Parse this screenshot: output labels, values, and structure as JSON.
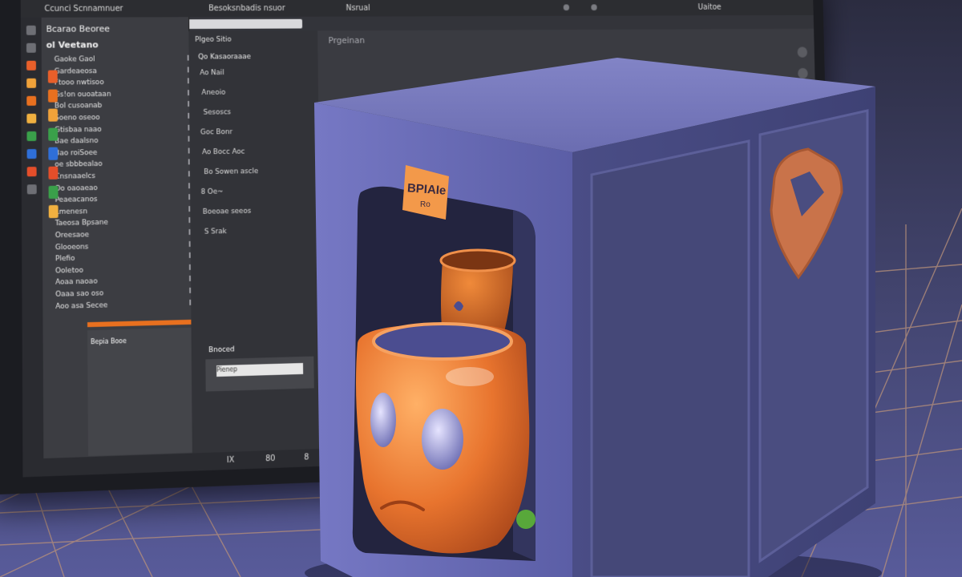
{
  "editor": {
    "title": "Ccunci Scnnamnuer",
    "menu_item": "Besoksnbadis nsuor",
    "menu_item_2": "Nsrual",
    "top_right": "Uaitoe",
    "field_label": "Plgeo Sitio",
    "scene_panel": {
      "title": "Bcarao Beoree",
      "header": "ol Veetano",
      "rows": [
        "Gaoke Gaol",
        "Gardeaeosa",
        "Ftooo nwtisoo",
        "Gs!on ouoataan",
        "Bol cusoanab",
        "Soeno oseoo",
        "Gtisbaa naao",
        "Bae daalsno",
        "Bao roiSoee",
        "oe sbbbealao",
        "Cnsnaaelcs",
        "Oo oaoaeao",
        "Peaeacanos",
        "Lmenesn",
        "Taeosa Bpsane",
        "Oreesaoe",
        "Glooeons",
        "Plefio",
        "Ooletoo",
        "Aoaa naoao",
        "Oaaa sao oso",
        "Aoo asa Secee"
      ],
      "lower_label": "Bepia Booe"
    },
    "panel2": {
      "header": "Qo Kasaoraaae",
      "rows": [
        "Ao Nail",
        "Aneoio",
        "Sesoscs",
        "Goc Bonr",
        "Ao Bocc Aoc",
        "Bo Sowen ascle",
        "8 Oe~",
        "Boeoae seeos",
        "S Srak"
      ],
      "bottom_title": "Bnoced",
      "bottom_field": "Pienep"
    },
    "viewport_title": "Prgeinan",
    "status": [
      "IX",
      "80",
      "8"
    ]
  },
  "sticky_note": {
    "text": "BPIAIe",
    "sub": "Ro"
  },
  "colors": {
    "accent_orange": "#e8701f",
    "cabinet_blue": "#5f62a6",
    "mug_orange": "#e8742e"
  }
}
